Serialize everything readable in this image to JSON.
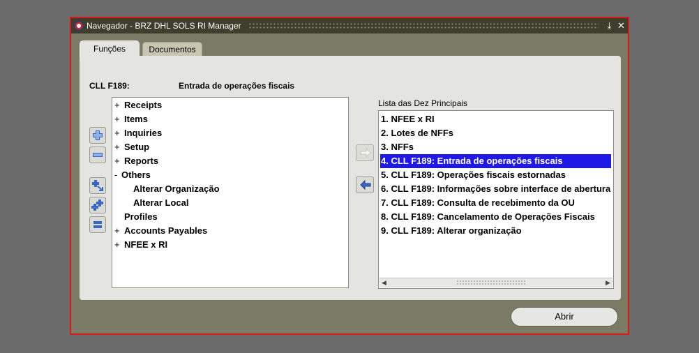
{
  "window": {
    "title": "Navegador - BRZ DHL SOLS RI Manager",
    "minimize_glyph": "⤓",
    "close_glyph": "✕"
  },
  "tabs": [
    {
      "label": "Funções",
      "active": true
    },
    {
      "label": "Documentos",
      "active": false
    }
  ],
  "header": {
    "code": "CLL F189:",
    "function_name": "Entrada de operações fiscais"
  },
  "tree": [
    {
      "expander": "+",
      "label": "Receipts"
    },
    {
      "expander": "+",
      "label": "Items"
    },
    {
      "expander": "+",
      "label": "Inquiries"
    },
    {
      "expander": "+",
      "label": "Setup"
    },
    {
      "expander": "+",
      "label": "Reports"
    },
    {
      "expander": "-",
      "label": "Others"
    },
    {
      "expander": "",
      "label": "Alterar Organização"
    },
    {
      "expander": "",
      "label": "Alterar Local"
    },
    {
      "expander": "",
      "label": "Profiles"
    },
    {
      "expander": "+",
      "label": "Accounts Payables"
    },
    {
      "expander": "+",
      "label": "NFEE x RI"
    }
  ],
  "side_buttons": [
    {
      "name": "expand-button",
      "icon": "expand-icon"
    },
    {
      "name": "collapse-button",
      "icon": "collapse-icon"
    },
    {
      "name": "expand-branch-button",
      "icon": "expand-branch-icon"
    },
    {
      "name": "expand-all-button",
      "icon": "expand-all-icon"
    },
    {
      "name": "collapse-all-button",
      "icon": "collapse-all-icon"
    }
  ],
  "top10": {
    "label": "Lista das Dez Principais",
    "selected_index": 3,
    "items": [
      "1. NFEE x RI",
      "2. Lotes de NFFs",
      "3. NFFs",
      "4. CLL F189: Entrada de operações fiscais",
      "5. CLL F189: Operações fiscais estornadas",
      "6. CLL F189: Informações sobre interface de abertura",
      "7. CLL F189: Consulta de recebimento da OU",
      "8. CLL F189: Cancelamento de Operações Fiscais",
      "9. CLL F189: Alterar organização"
    ]
  },
  "open_button": {
    "label": "Abrir"
  },
  "colors": {
    "selection": "#1f19e8",
    "window_border": "#d41a1a"
  }
}
